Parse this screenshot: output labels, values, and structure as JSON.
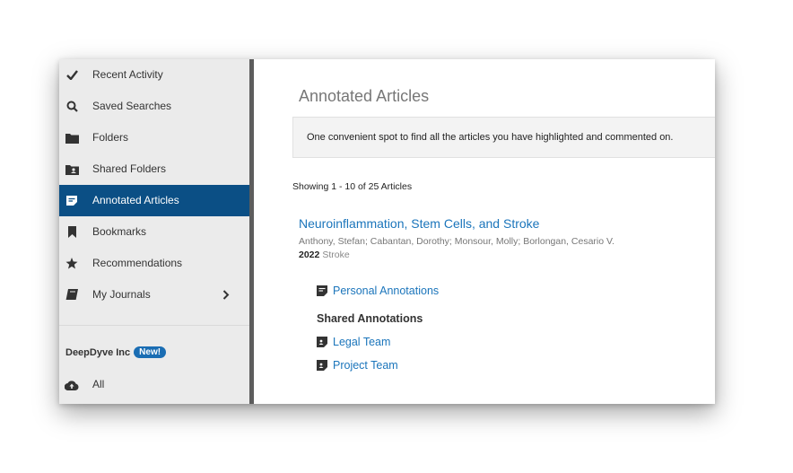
{
  "sidebar": {
    "items": [
      {
        "label": "Recent Activity",
        "icon": "check-icon"
      },
      {
        "label": "Saved Searches",
        "icon": "search-icon"
      },
      {
        "label": "Folders",
        "icon": "folder-icon"
      },
      {
        "label": "Shared Folders",
        "icon": "shared-folder-icon"
      },
      {
        "label": "Annotated Articles",
        "icon": "annotation-icon",
        "active": true
      },
      {
        "label": "Bookmarks",
        "icon": "bookmark-icon"
      },
      {
        "label": "Recommendations",
        "icon": "star-icon"
      },
      {
        "label": "My Journals",
        "icon": "journals-icon"
      }
    ],
    "org": {
      "name": "DeepDyve Inc",
      "badge": "New!"
    },
    "all_label": "All"
  },
  "main": {
    "title": "Annotated Articles",
    "info": "One convenient spot to find all the articles you have highlighted and commented on.",
    "showing": "Showing 1 - 10 of 25 Articles",
    "article": {
      "title": "Neuroinflammation, Stem Cells, and Stroke",
      "authors": "Anthony, Stefan; Cabantan, Dorothy; Monsour, Molly; Borlongan, Cesario V.",
      "year": "2022",
      "journal": "Stroke",
      "personal_label": "Personal Annotations",
      "shared_heading": "Shared Annotations",
      "shared": [
        "Legal Team",
        "Project Team"
      ]
    }
  },
  "colors": {
    "active_bg": "#0b4f85",
    "link": "#1b75bb",
    "sidebar_bg": "#ebebeb"
  }
}
